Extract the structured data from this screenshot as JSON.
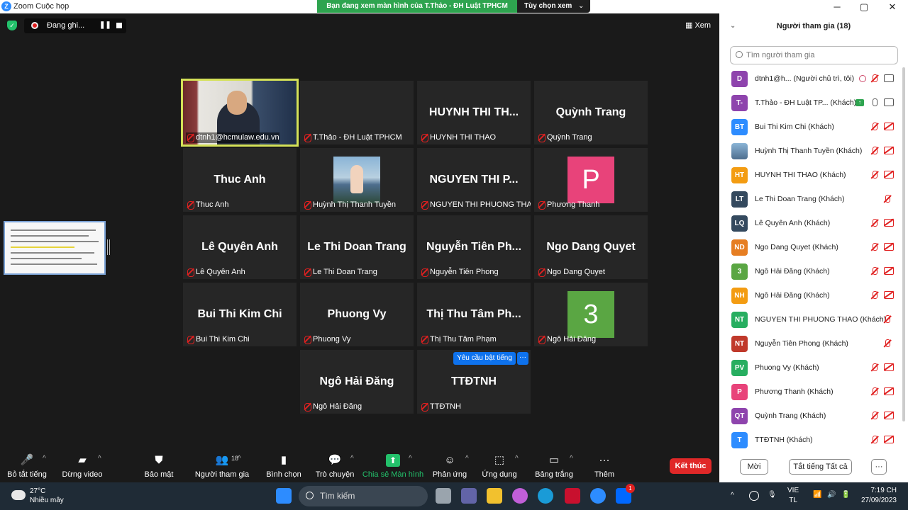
{
  "window": {
    "title": "Zoom Cuộc họp",
    "logo": "Z",
    "minimize": "─",
    "maximize": "▢",
    "close": "✕"
  },
  "share_banner": {
    "message": "Bạn đang xem màn hình của T.Thảo - ĐH Luật TPHCM",
    "options_label": "Tùy chọn xem",
    "chevron": "⌄"
  },
  "recording": {
    "label": "Đang ghi...",
    "pause": "❚❚"
  },
  "view_button": "▦ Xem",
  "tiles": [
    {
      "big": "",
      "label": "dtnh1@hcmulaw.edu.vn",
      "type": "camera"
    },
    {
      "big": "",
      "label": "T.Thảo - ĐH Luật TPHCM",
      "type": "blank"
    },
    {
      "big": "HUYNH THI TH...",
      "label": "HUYNH THI THAO",
      "type": "name"
    },
    {
      "big": "Quỳnh Trang",
      "label": "Quỳnh Trang",
      "type": "name"
    },
    {
      "big": "Thuc Anh",
      "label": "Thuc Anh",
      "type": "name"
    },
    {
      "big": "",
      "label": "Huỳnh Thị Thanh Tuyền",
      "type": "photo"
    },
    {
      "big": "NGUYEN THI P...",
      "label": "NGUYEN THI PHUONG THAO",
      "type": "name"
    },
    {
      "big": "P",
      "label": "Phương Thanh",
      "type": "avatar",
      "color": "#e8437a"
    },
    {
      "big": "Lê Quyên Anh",
      "label": "Lê Quyên Anh",
      "type": "name"
    },
    {
      "big": "Le Thi Doan Trang",
      "label": "Le Thi Doan Trang",
      "type": "name"
    },
    {
      "big": "Nguyễn Tiên Ph...",
      "label": "Nguyễn Tiên Phong",
      "type": "name"
    },
    {
      "big": "Ngo Dang Quyet",
      "label": "Ngo Dang Quyet",
      "type": "name"
    },
    {
      "big": "Bui Thi Kim Chi",
      "label": "Bui Thi Kim Chi",
      "type": "name"
    },
    {
      "big": "Phuong Vy",
      "label": "Phuong Vy",
      "type": "name"
    },
    {
      "big": "Thị Thu Tâm Ph...",
      "label": "Thị Thu Tâm Phạm",
      "type": "name"
    },
    {
      "big": "3",
      "label": "Ngô Hải Đăng",
      "type": "avatar",
      "color": "#5aa643"
    },
    {
      "big": "Ngô Hải Đăng",
      "label": "Ngô Hải Đăng",
      "type": "name"
    },
    {
      "big": "TTĐTNH",
      "label": "TTĐTNH",
      "type": "name"
    }
  ],
  "unmute_request": {
    "label": "Yêu cầu bật tiếng",
    "more": "···"
  },
  "panel": {
    "title": "Người tham gia (18)",
    "collapse": "⌄",
    "search_placeholder": "Tìm người tham gia",
    "participants": [
      {
        "initials": "D",
        "color": "#8e44ad",
        "name": "dtnh1@h... (Người chủ trì, tôi)",
        "mic": "off",
        "video": "gray",
        "host": true
      },
      {
        "initials": "T-",
        "color": "#8e44ad",
        "name": "T.Thảo - ĐH Luật TP... (Khách)",
        "mic": "on",
        "video": "gray",
        "share": true
      },
      {
        "initials": "BT",
        "color": "#2d8cff",
        "name": "Bui Thi Kim Chi (Khách)",
        "mic": "off",
        "video": "off"
      },
      {
        "initials": "",
        "color": "#7aa0c8",
        "name": "Huỳnh Thị Thanh Tuyền (Khách)",
        "mic": "off",
        "video": "off"
      },
      {
        "initials": "HT",
        "color": "#f39c12",
        "name": "HUYNH THI THAO (Khách)",
        "mic": "off",
        "video": "off"
      },
      {
        "initials": "LT",
        "color": "#34495e",
        "name": "Le Thi Doan Trang (Khách)",
        "mic": "off",
        "video": "none"
      },
      {
        "initials": "LQ",
        "color": "#34495e",
        "name": "Lê Quyên Anh (Khách)",
        "mic": "off",
        "video": "off"
      },
      {
        "initials": "ND",
        "color": "#e67e22",
        "name": "Ngo Dang Quyet (Khách)",
        "mic": "off",
        "video": "off"
      },
      {
        "initials": "3",
        "color": "#5aa643",
        "name": "Ngô Hải Đăng (Khách)",
        "mic": "off",
        "video": "off"
      },
      {
        "initials": "NH",
        "color": "#f39c12",
        "name": "Ngô Hải Đăng (Khách)",
        "mic": "off",
        "video": "off"
      },
      {
        "initials": "NT",
        "color": "#27ae60",
        "name": "NGUYEN THI PHUONG THAO (Khách)",
        "mic": "off",
        "video": "none"
      },
      {
        "initials": "NT",
        "color": "#c0392b",
        "name": "Nguyễn Tiên Phong (Khách)",
        "mic": "off",
        "video": "none"
      },
      {
        "initials": "PV",
        "color": "#27ae60",
        "name": "Phuong Vy (Khách)",
        "mic": "off",
        "video": "off"
      },
      {
        "initials": "P",
        "color": "#e8437a",
        "name": "Phương Thanh (Khách)",
        "mic": "off",
        "video": "off"
      },
      {
        "initials": "QT",
        "color": "#8e44ad",
        "name": "Quỳnh Trang (Khách)",
        "mic": "off",
        "video": "off"
      },
      {
        "initials": "T",
        "color": "#2d8cff",
        "name": "TTĐTNH (Khách)",
        "mic": "off",
        "video": "off"
      }
    ],
    "invite_label": "Mời",
    "mute_all_label": "Tắt tiếng Tất cả",
    "more_label": "···"
  },
  "toolbar": [
    {
      "label": "Bỏ tắt tiếng",
      "icon": "mic-off-icon",
      "caret": true
    },
    {
      "label": "Dừng video",
      "icon": "video-icon",
      "caret": true
    },
    {
      "label": "Bảo mật",
      "icon": "shield-icon",
      "caret": false
    },
    {
      "label": "Người tham gia",
      "icon": "participants-icon",
      "caret": true,
      "count": "18"
    },
    {
      "label": "Bình chọn",
      "icon": "poll-icon",
      "caret": false
    },
    {
      "label": "Trò chuyện",
      "icon": "chat-icon",
      "caret": true
    },
    {
      "label": "Chia sẻ Màn hình",
      "icon": "share-screen-icon",
      "caret": true,
      "accent": "#23c16b"
    },
    {
      "label": "Phản ứng",
      "icon": "reaction-icon",
      "caret": true
    },
    {
      "label": "Ứng dụng",
      "icon": "apps-icon",
      "caret": true
    },
    {
      "label": "Bảng trắng",
      "icon": "whiteboard-icon",
      "caret": true
    },
    {
      "label": "Thêm",
      "icon": "more-icon",
      "caret": false
    }
  ],
  "end_button": "Kết thúc",
  "taskbar": {
    "temperature": "27°C",
    "weather": "Nhiều mây",
    "search": "Tìm kiếm",
    "lang_1": "VIE",
    "lang_2": "TL",
    "time": "7:19 CH",
    "date": "27/09/2023",
    "up_arrow": "^",
    "zalo_badge": "1"
  }
}
